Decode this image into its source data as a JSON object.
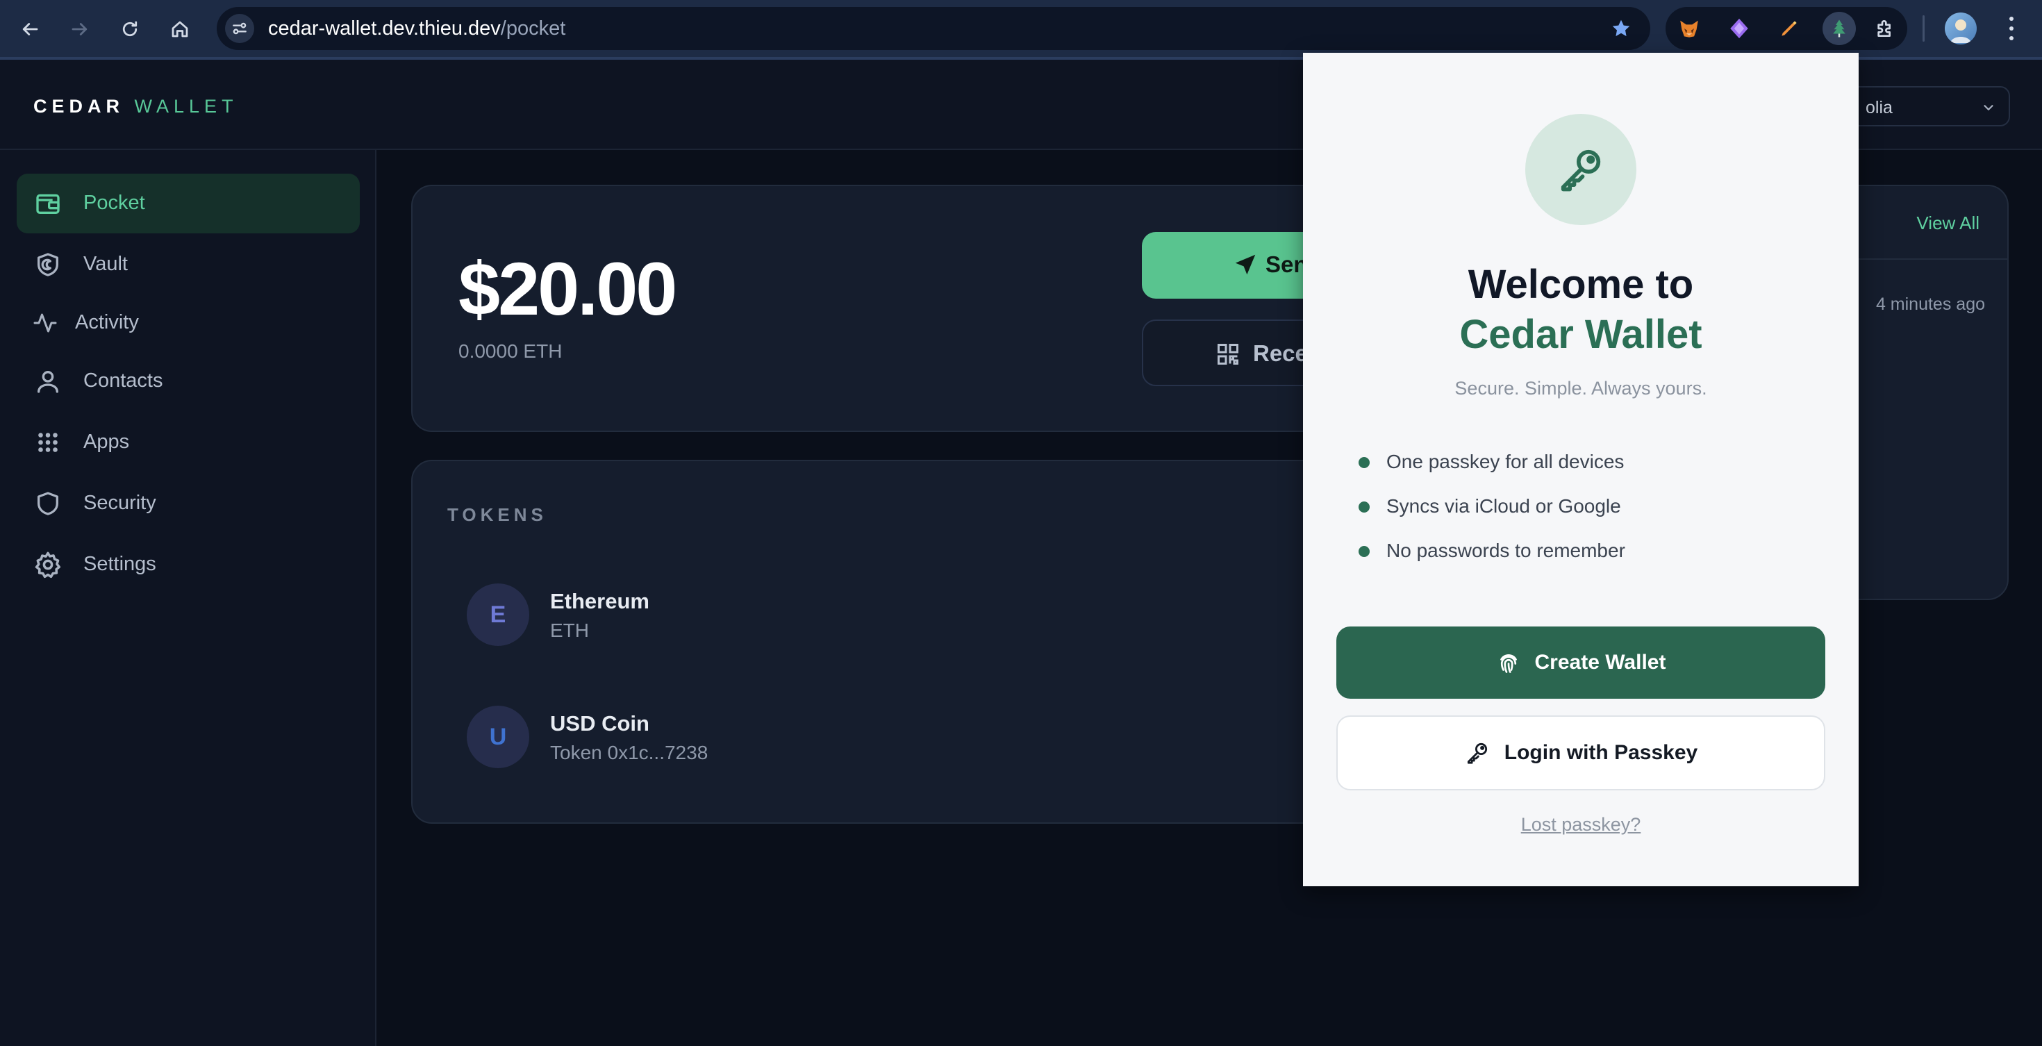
{
  "browser": {
    "url_host": "cedar-wallet.dev.thieu.dev",
    "url_path": "/pocket",
    "extension_icons": [
      "fox-extension-icon",
      "diamond-extension-icon",
      "pen-extension-icon",
      "cedar-tree-extension-icon",
      "puzzle-extensions-icon"
    ]
  },
  "header": {
    "logo_primary": "CEDAR",
    "logo_secondary": "WALLET",
    "network_visible": "olia"
  },
  "sidebar": {
    "items": [
      {
        "label": "Pocket",
        "icon": "wallet-icon",
        "active": true
      },
      {
        "label": "Vault",
        "icon": "vault-shield-icon"
      },
      {
        "label": "Activity",
        "icon": "activity-icon"
      },
      {
        "label": "Contacts",
        "icon": "contacts-icon"
      },
      {
        "label": "Apps",
        "icon": "apps-grid-icon"
      },
      {
        "label": "Security",
        "icon": "shield-icon"
      },
      {
        "label": "Settings",
        "icon": "gear-icon"
      }
    ]
  },
  "balance": {
    "usd": "$20.00",
    "eth": "0.0000 ETH",
    "send_label": "Sen",
    "receive_label": "Rece"
  },
  "tokens": {
    "title": "TOKENS",
    "items": [
      {
        "initial": "E",
        "name": "Ethereum",
        "sub": "ETH",
        "color": "#6f7ad6"
      },
      {
        "initial": "U",
        "name": "USD Coin",
        "sub": "Token 0x1c...7238",
        "color": "#3f72d0"
      }
    ]
  },
  "activity": {
    "view_all": "View All",
    "latest_time": "4 minutes ago"
  },
  "popup": {
    "welcome": "Welcome to",
    "brand": "Cedar Wallet",
    "tagline": "Secure. Simple. Always yours.",
    "features": [
      "One passkey for all devices",
      "Syncs via iCloud or Google",
      "No passwords to remember"
    ],
    "create_label": "Create Wallet",
    "login_label": "Login with Passkey",
    "lost_label": "Lost passkey?"
  },
  "colors": {
    "accent_green": "#59c48f",
    "brand_dark_green": "#2b6650",
    "background": "#0c111c"
  }
}
